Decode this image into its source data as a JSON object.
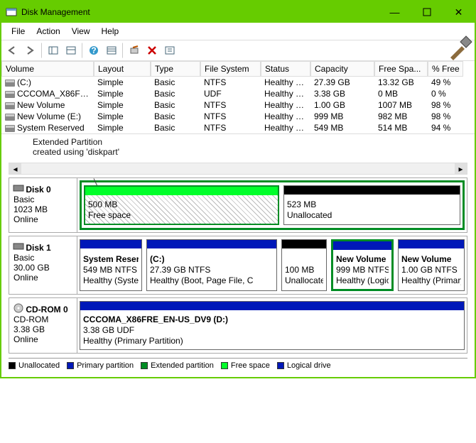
{
  "title": "Disk Management",
  "menus": [
    "File",
    "Action",
    "View",
    "Help"
  ],
  "columns": [
    "Volume",
    "Layout",
    "Type",
    "File System",
    "Status",
    "Capacity",
    "Free Spa...",
    "% Free"
  ],
  "volumes": [
    {
      "name": "(C:)",
      "layout": "Simple",
      "type": "Basic",
      "fs": "NTFS",
      "status": "Healthy (B...",
      "cap": "27.39 GB",
      "free": "13.32 GB",
      "pct": "49 %"
    },
    {
      "name": "CCCOMA_X86FRE...",
      "layout": "Simple",
      "type": "Basic",
      "fs": "UDF",
      "status": "Healthy (P...",
      "cap": "3.38 GB",
      "free": "0 MB",
      "pct": "0 %"
    },
    {
      "name": "New Volume",
      "layout": "Simple",
      "type": "Basic",
      "fs": "NTFS",
      "status": "Healthy (P...",
      "cap": "1.00 GB",
      "free": "1007 MB",
      "pct": "98 %"
    },
    {
      "name": "New Volume (E:)",
      "layout": "Simple",
      "type": "Basic",
      "fs": "NTFS",
      "status": "Healthy (L...",
      "cap": "999 MB",
      "free": "982 MB",
      "pct": "98 %"
    },
    {
      "name": "System Reserved",
      "layout": "Simple",
      "type": "Basic",
      "fs": "NTFS",
      "status": "Healthy (S...",
      "cap": "549 MB",
      "free": "514 MB",
      "pct": "94 %"
    }
  ],
  "annotation": {
    "l1": "Extended Partition",
    "l2": "created using 'diskpart'"
  },
  "disk0": {
    "name": "Disk 0",
    "type": "Basic",
    "size": "1023 MB",
    "state": "Online",
    "p1": {
      "size": "500 MB",
      "label": "Free space"
    },
    "p2": {
      "size": "523 MB",
      "label": "Unallocated"
    }
  },
  "disk1": {
    "name": "Disk 1",
    "type": "Basic",
    "size": "30.00 GB",
    "state": "Online",
    "p1": {
      "title": "System Reserv",
      "sub": "549 MB NTFS",
      "stat": "Healthy (Syster"
    },
    "p2": {
      "title": "(C:)",
      "sub": "27.39 GB NTFS",
      "stat": "Healthy (Boot, Page File, C"
    },
    "p3": {
      "sub": "100 MB",
      "stat": "Unallocate"
    },
    "p4": {
      "title": "New Volume  (",
      "sub": "999 MB NTFS",
      "stat": "Healthy (Logica"
    },
    "p5": {
      "title": "New Volume",
      "sub": "1.00 GB NTFS",
      "stat": "Healthy (Primary"
    }
  },
  "cdrom": {
    "name": "CD-ROM 0",
    "type": "CD-ROM",
    "size": "3.38 GB",
    "state": "Online",
    "p1": {
      "title": "CCCOMA_X86FRE_EN-US_DV9  (D:)",
      "sub": "3.38 GB UDF",
      "stat": "Healthy (Primary Partition)"
    }
  },
  "legend": {
    "a": "Unallocated",
    "b": "Primary partition",
    "c": "Extended partition",
    "d": "Free space",
    "e": "Logical drive"
  },
  "colors": {
    "unalloc": "#000",
    "primary": "#0018b8",
    "extended": "#008c24",
    "free": "#00ff2a",
    "logical": "#0018b8"
  }
}
